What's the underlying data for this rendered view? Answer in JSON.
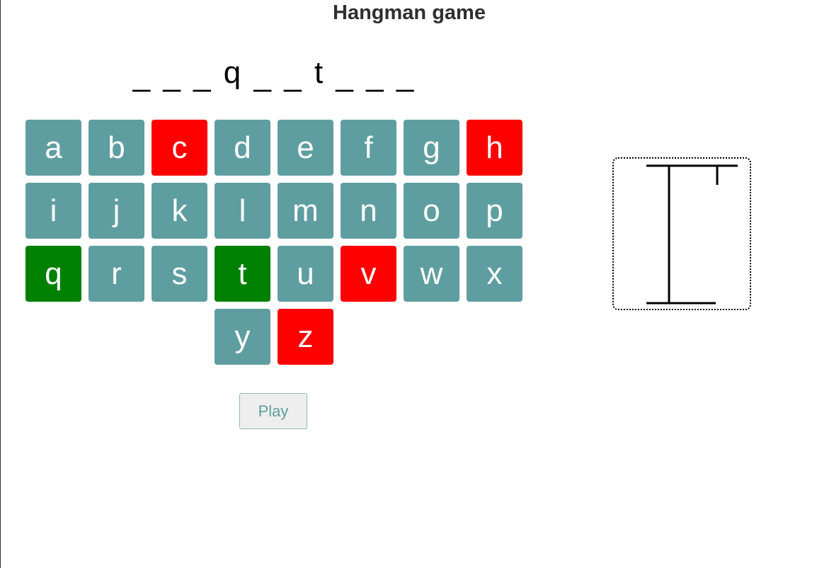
{
  "title": "Hangman game",
  "word_slots": [
    "_",
    "_",
    "_",
    "q",
    "_",
    "_",
    "t",
    "_",
    "_",
    "_"
  ],
  "keyboard": {
    "keys": [
      {
        "letter": "a",
        "state": "unused"
      },
      {
        "letter": "b",
        "state": "unused"
      },
      {
        "letter": "c",
        "state": "wrong"
      },
      {
        "letter": "d",
        "state": "unused"
      },
      {
        "letter": "e",
        "state": "unused"
      },
      {
        "letter": "f",
        "state": "unused"
      },
      {
        "letter": "g",
        "state": "unused"
      },
      {
        "letter": "h",
        "state": "wrong"
      },
      {
        "letter": "i",
        "state": "unused"
      },
      {
        "letter": "j",
        "state": "unused"
      },
      {
        "letter": "k",
        "state": "unused"
      },
      {
        "letter": "l",
        "state": "unused"
      },
      {
        "letter": "m",
        "state": "unused"
      },
      {
        "letter": "n",
        "state": "unused"
      },
      {
        "letter": "o",
        "state": "unused"
      },
      {
        "letter": "p",
        "state": "unused"
      },
      {
        "letter": "q",
        "state": "correct"
      },
      {
        "letter": "r",
        "state": "unused"
      },
      {
        "letter": "s",
        "state": "unused"
      },
      {
        "letter": "t",
        "state": "correct"
      },
      {
        "letter": "u",
        "state": "unused"
      },
      {
        "letter": "v",
        "state": "wrong"
      },
      {
        "letter": "w",
        "state": "unused"
      },
      {
        "letter": "x",
        "state": "unused"
      },
      {
        "letter": "y",
        "state": "unused"
      },
      {
        "letter": "z",
        "state": "wrong"
      }
    ]
  },
  "play_button": {
    "label": "Play"
  },
  "gallows": {
    "parts_drawn": [
      "base",
      "pole",
      "beam",
      "rope"
    ]
  },
  "colors": {
    "key_unused": "#5f9ea0",
    "key_wrong": "#ff0000",
    "key_correct": "#008000",
    "key_text": "#ffffff"
  }
}
